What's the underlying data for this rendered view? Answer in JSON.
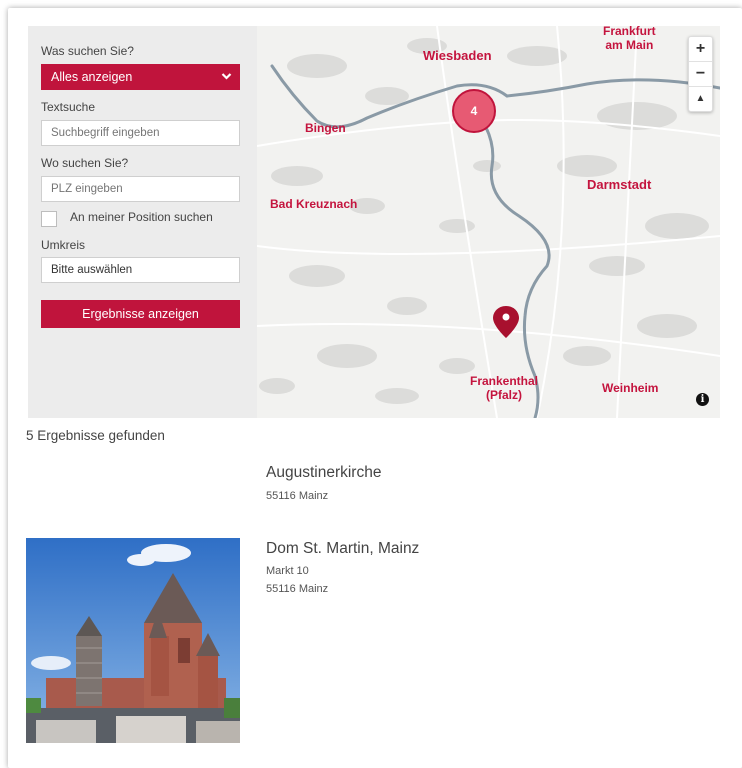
{
  "search": {
    "what_label": "Was suchen Sie?",
    "category_value": "Alles anzeigen",
    "text_label": "Textsuche",
    "text_placeholder": "Suchbegriff eingeben",
    "where_label": "Wo suchen Sie?",
    "plz_placeholder": "PLZ eingeben",
    "position_checkbox_label": "An meiner Position suchen",
    "radius_label": "Umkreis",
    "radius_value": "Bitte auswählen",
    "submit_label": "Ergebnisse anzeigen"
  },
  "map": {
    "cities": [
      "Frankfurt am Main",
      "Wiesbaden",
      "Bingen",
      "Darmstadt",
      "Bad Kreuznach",
      "Frankenthal (Pfalz)",
      "Weinheim"
    ],
    "frankfurt_line1": "Frankfurt",
    "frankfurt_line2": "am Main",
    "wiesbaden": "Wiesbaden",
    "bingen": "Bingen",
    "darmstadt": "Darmstadt",
    "bad_kreuznach": "Bad Kreuznach",
    "frankenthal_line1": "Frankenthal",
    "frankenthal_line2": "(Pfalz)",
    "weinheim": "Weinheim",
    "cluster_count": "4",
    "zoom_in": "+",
    "zoom_out": "−",
    "reset_north": "▲",
    "info": "i",
    "accent_color": "#c0143c"
  },
  "results": {
    "count_text": "5 Ergebnisse gefunden",
    "items": [
      {
        "title": "Augustinerkirche",
        "line1": "55116 Mainz"
      },
      {
        "title": "Dom St. Martin, Mainz",
        "line1": "Markt 10",
        "line2": "55116 Mainz"
      }
    ]
  }
}
